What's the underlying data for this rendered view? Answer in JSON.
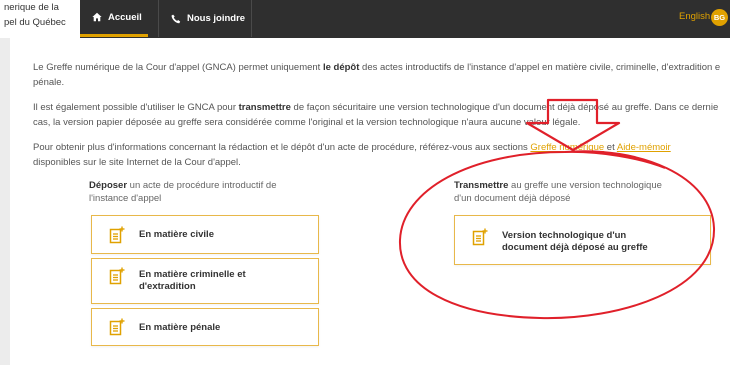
{
  "header": {
    "logo_line1": "nerique de la",
    "logo_line2": "pel du Québec",
    "nav": [
      {
        "label": "Accueil",
        "icon": "home-icon"
      },
      {
        "label": "Nous joindre",
        "icon": "phone-icon"
      }
    ],
    "language": "English",
    "user_initials": "BG"
  },
  "content": {
    "p1_a": "Le Greffe numérique de la Cour d'appel (GNCA) permet uniquement ",
    "p1_b": "le dépôt",
    "p1_c": " des actes introductifs de l'instance d'appel en matière civile, criminelle, d'extradition e",
    "p1_d": "pénale.",
    "p2_a": "Il est également possible d'utiliser le GNCA pour ",
    "p2_b": "transmettre",
    "p2_c": " de façon sécuritaire une version technologique d'un document déjà déposé au greffe. Dans ce dernie",
    "p2_d": "cas, la version papier déposée au greffe sera considérée comme l'original et la version technologique n'aura aucune valeur légale.",
    "p3_a": "Pour obtenir plus d'informations concernant la rédaction et le dépôt d'un acte de procédure, référez-vous aux sections ",
    "p3_link1": "Greffe numérique",
    "p3_and": " et ",
    "p3_link2": "Aide-mémoir",
    "p3_b": "disponibles sur le site Internet de la Cour d'appel.",
    "left_title_bold": "Déposer",
    "left_title_rest": " un acte de procédure introductif de",
    "left_title_line2": "l'instance d'appel",
    "right_title_bold": "Transmettre",
    "right_title_rest": " au greffe une version technologique",
    "right_title_line2": "d'un document déjà déposé",
    "buttons": {
      "civile": "En matière civile",
      "crim_line1": "En matière criminelle et",
      "crim_line2": "d'extradition",
      "penale": "En matière pénale",
      "version_line1": "Version technologique d'un",
      "version_line2": "document déjà déposé au greffe"
    }
  },
  "colors": {
    "accent": "#e0a100",
    "topbar": "#2f2f2f",
    "annotation": "#e0202a"
  }
}
